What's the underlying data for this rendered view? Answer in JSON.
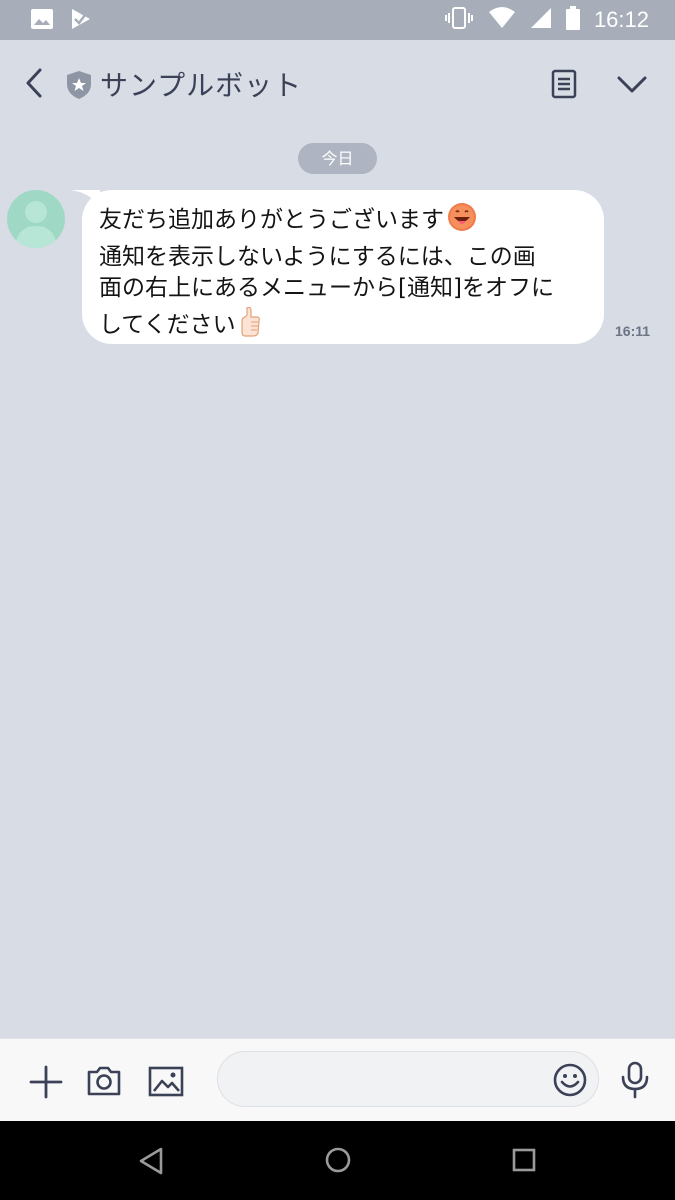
{
  "status_bar": {
    "time": "16:12",
    "left_icons": [
      "image-icon",
      "check-flag-icon"
    ],
    "right_icons": [
      "vibrate-icon",
      "wifi-icon",
      "cell-signal-icon",
      "battery-icon"
    ]
  },
  "header": {
    "title": "サンプルボット",
    "back_icon": "chevron-left-icon",
    "badge_icon": "shield-star-icon",
    "right_icons": [
      "notes-icon",
      "chevron-down-icon"
    ]
  },
  "date_separator": "今日",
  "messages": [
    {
      "sender_avatar": "default-avatar",
      "lines": [
        "友だち追加ありがとうございます",
        "通知を表示しないようにするには、この画",
        "面の右上にあるメニューから[通知]をオフに",
        "してください"
      ],
      "emojis": [
        "grinning-tongue-emoji",
        "thumbs-up-emoji"
      ],
      "time": "16:11"
    }
  ],
  "input_bar": {
    "placeholder": "",
    "icons": [
      "plus-icon",
      "camera-icon",
      "image-icon",
      "emoji-icon",
      "microphone-icon"
    ]
  },
  "nav_bar": {
    "icons": [
      "nav-back-icon",
      "nav-home-icon",
      "nav-recent-icon"
    ]
  },
  "colors": {
    "background": "#d8dce5",
    "status_bar": "#a7adb9",
    "bubble": "#ffffff",
    "avatar": "#9fd9c5",
    "date_pill": "#aeb4c1"
  }
}
